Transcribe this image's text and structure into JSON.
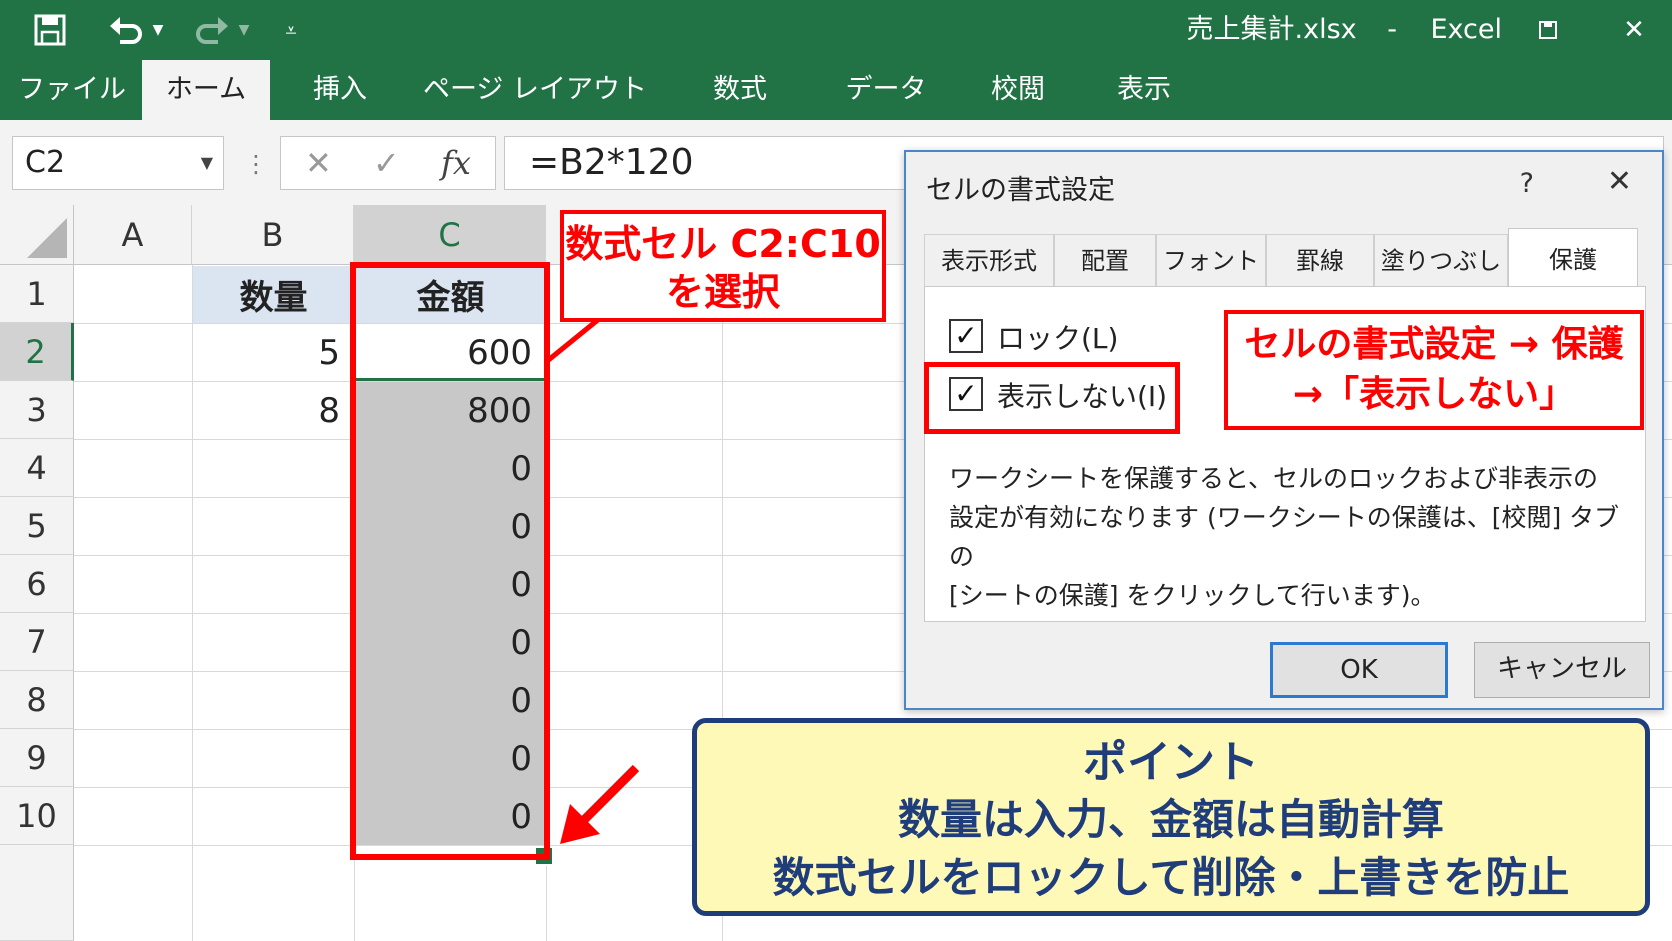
{
  "titlebar": {
    "filename": "売上集計.xlsx",
    "separator": "-",
    "app_name": "Excel",
    "accent_color": "#217346"
  },
  "ribbon": {
    "tabs": [
      "ファイル",
      "ホーム",
      "挿入",
      "ページ レイアウト",
      "数式",
      "データ",
      "校閲",
      "表示"
    ],
    "active_tab": "ホーム"
  },
  "formula_bar": {
    "name_box": "C2",
    "formula": "=B2*120",
    "fx_label": "fx"
  },
  "sheet": {
    "columns": [
      "A",
      "B",
      "C"
    ],
    "rows": [
      "1",
      "2",
      "3",
      "4",
      "5",
      "6",
      "7",
      "8",
      "9",
      "10"
    ],
    "b1": "数量",
    "c1": "金額",
    "b_values": [
      "5",
      "8"
    ],
    "c_values": [
      "600",
      "800",
      "0",
      "0",
      "0",
      "0",
      "0",
      "0",
      "0"
    ],
    "selected_cell": "C2"
  },
  "dialog": {
    "title": "セルの書式設定",
    "help": "?",
    "close": "✕",
    "tabs": [
      "表示形式",
      "配置",
      "フォント",
      "罫線",
      "塗りつぶし",
      "保護"
    ],
    "active_tab": "保護",
    "lock_label": "ロック(L)",
    "lock_checked": true,
    "hidden_label": "表示しない(I)",
    "hidden_checked": true,
    "description_1": "ワークシートを保護すると、セルのロックおよび非表示の",
    "description_2": "設定が有効になります (ワークシートの保護は、[校閲] タブの",
    "description_3": "[シートの保護] をクリックして行います)。",
    "ok_label": "OK",
    "cancel_label": "キャンセル"
  },
  "annotations": {
    "callout_select_1": "数式セル C2:C10",
    "callout_select_2": "を選択",
    "callout_protect_1": "セルの書式設定 → 保護",
    "callout_protect_2": "→「表示しない」",
    "point_title": "ポイント",
    "point_line_1": "数量は入力、金額は自動計算",
    "point_line_2": "数式セルをロックして削除・上書きを防止",
    "highlight_color": "#ff0000",
    "point_bg_color": "#fff9b8",
    "point_border_color": "#1f3d7a"
  }
}
